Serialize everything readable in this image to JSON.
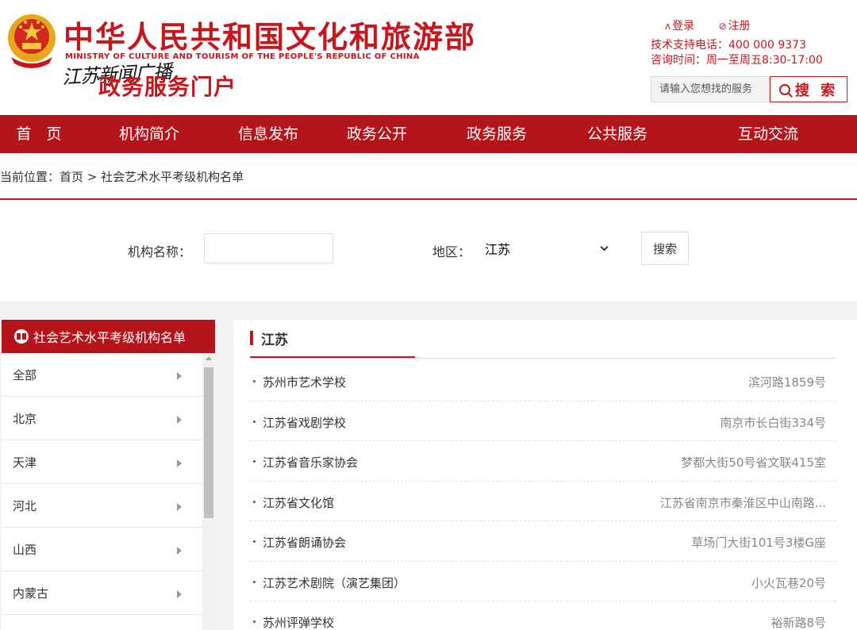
{
  "header": {
    "title": "中华人民共和国文化和旅游部",
    "subtitle_en": "MINISTRY OF CULTURE AND TOURISM OF THE PEOPLE'S REPUBLIC OF CHINA",
    "watermark": "江苏新闻广播",
    "portal": "政务服务门户",
    "login": "登录",
    "register": "注册",
    "support_phone": "技术支持电话：400 000 9373",
    "support_hours": "咨询时间：周一至周五8:30-17:00",
    "search_placeholder": "请输入您想找的服务",
    "search_button": "搜 索"
  },
  "nav": {
    "items": [
      {
        "label": "首　页"
      },
      {
        "label": "机构简介"
      },
      {
        "label": "信息发布"
      },
      {
        "label": "政务公开"
      },
      {
        "label": "政务服务"
      },
      {
        "label": "公共服务"
      },
      {
        "label": "互动交流"
      }
    ]
  },
  "breadcrumb": "当前位置：首页 > 社会艺术水平考级机构名单",
  "filter": {
    "name_label": "机构名称：",
    "name_value": "",
    "region_label": "地区：",
    "region_value": "江苏",
    "search_button": "搜索"
  },
  "sidebar": {
    "title": "社会艺术水平考级机构名单",
    "items": [
      {
        "label": "全部"
      },
      {
        "label": "北京"
      },
      {
        "label": "天津"
      },
      {
        "label": "河北"
      },
      {
        "label": "山西"
      },
      {
        "label": "内蒙古"
      },
      {
        "label": ""
      }
    ]
  },
  "content": {
    "title": "江苏",
    "rows": [
      {
        "name": "苏州市艺术学校",
        "address": "滨河路1859号"
      },
      {
        "name": "江苏省戏剧学校",
        "address": "南京市长白街334号"
      },
      {
        "name": "江苏省音乐家协会",
        "address": "梦都大街50号省文联415室"
      },
      {
        "name": "江苏省文化馆",
        "address": "江苏省南京市秦淮区中山南路..."
      },
      {
        "name": "江苏省朗诵协会",
        "address": "草场门大街101号3楼G座"
      },
      {
        "name": "江苏艺术剧院（演艺集团）",
        "address": "小火瓦巷20号"
      },
      {
        "name": "苏州评弹学校",
        "address": "裕新路8号"
      }
    ]
  },
  "colors": {
    "brand_red": "#c8161d",
    "nav_red": "#b4151b"
  }
}
